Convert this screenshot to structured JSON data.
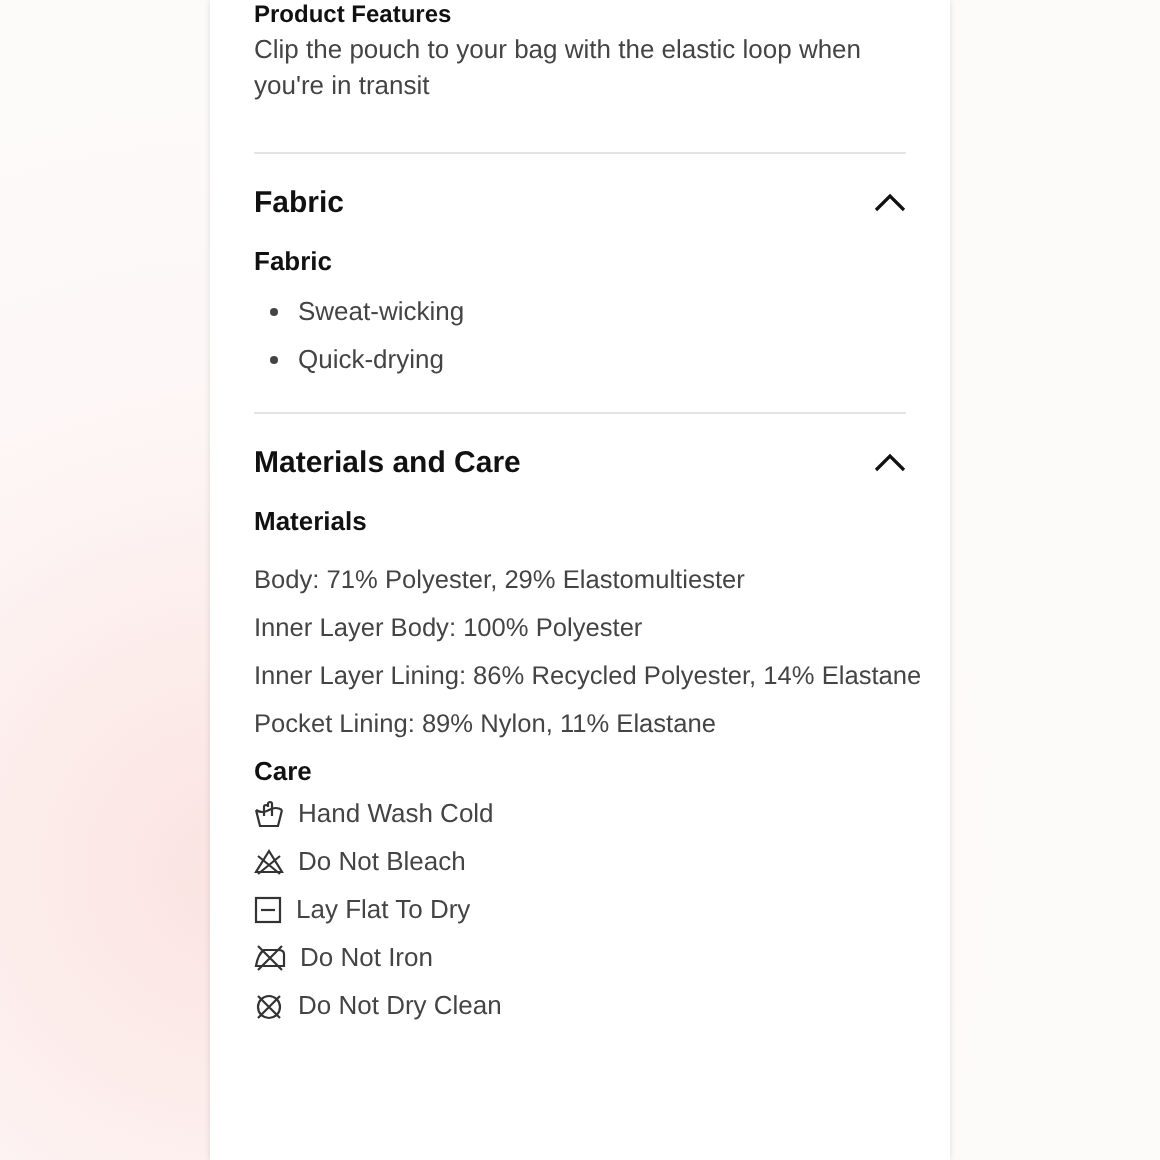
{
  "intro": {
    "title": "Product Features",
    "text": "Clip the pouch to your bag with the elastic loop when you're in transit"
  },
  "sections": [
    {
      "title": "Fabric",
      "expanded": true,
      "groups": [
        {
          "heading": "Fabric",
          "kind": "bullets",
          "items": [
            "Sweat-wicking",
            "Quick-drying"
          ]
        }
      ]
    },
    {
      "title": "Materials and Care",
      "expanded": true,
      "groups": [
        {
          "heading": "Materials",
          "kind": "lines",
          "items": [
            "Body: 71% Polyester, 29% Elastomultiester",
            "Inner Layer Body: 100% Polyester",
            "Inner Layer Lining: 86% Recycled Polyester, 14% Elastane",
            "Pocket Lining: 89% Nylon, 11% Elastane"
          ]
        },
        {
          "heading": "Care",
          "kind": "care",
          "items": [
            {
              "kind": "handwash",
              "label": "Hand Wash Cold"
            },
            {
              "kind": "nobleach",
              "label": "Do Not Bleach"
            },
            {
              "kind": "flatdry",
              "label": "Lay Flat To Dry"
            },
            {
              "kind": "noiron",
              "label": "Do Not Iron"
            },
            {
              "kind": "nodryclean",
              "label": "Do Not Dry Clean"
            }
          ]
        }
      ]
    }
  ]
}
